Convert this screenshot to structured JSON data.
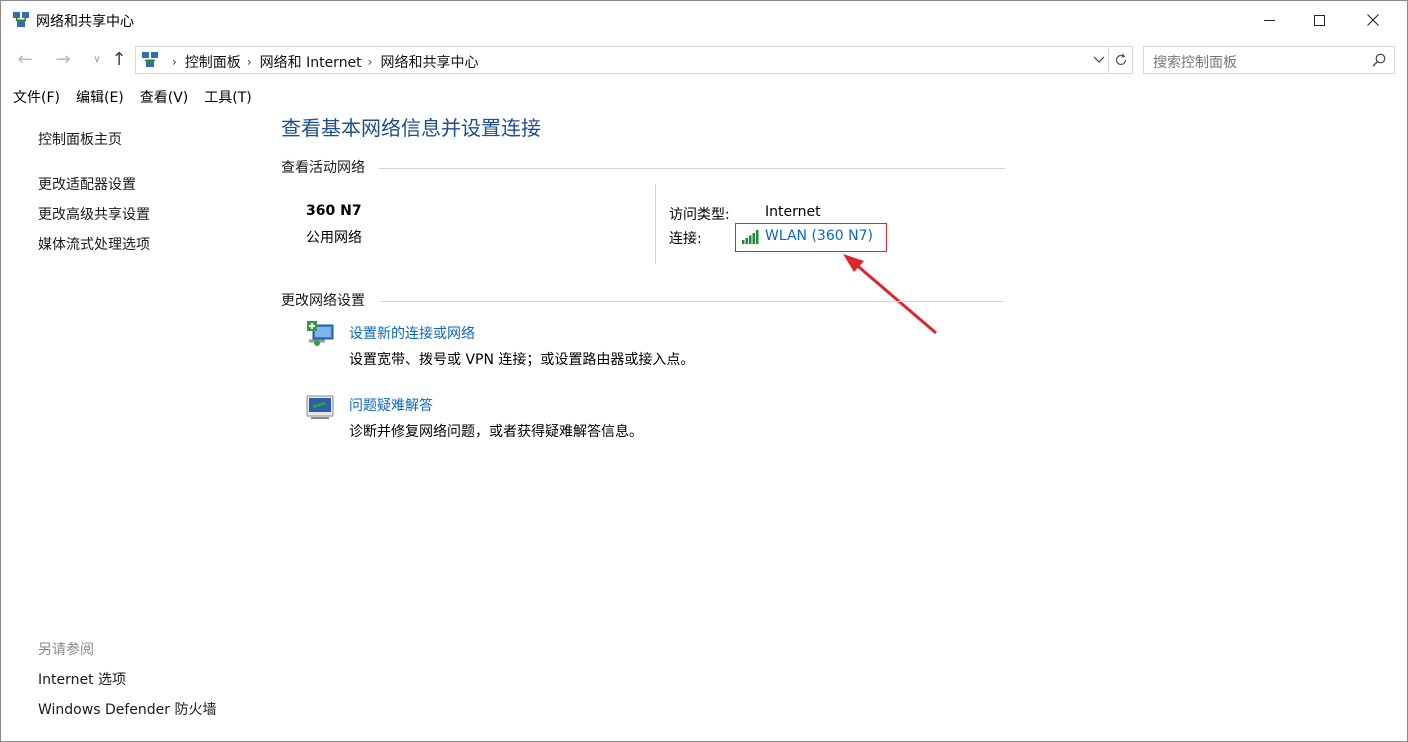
{
  "window": {
    "title": "网络和共享中心",
    "icon": "network-center-icon"
  },
  "nav": {
    "back": "←",
    "forward": "→",
    "recent": "∨",
    "up": "↑",
    "breadcrumbs": [
      "控制面板",
      "网络和 Internet",
      "网络和共享中心"
    ],
    "search_placeholder": "搜索控制面板"
  },
  "menu": [
    "文件(F)",
    "编辑(E)",
    "查看(V)",
    "工具(T)"
  ],
  "left_pane": {
    "home": "控制面板主页",
    "links": [
      "更改适配器设置",
      "更改高级共享设置",
      "媒体流式处理选项"
    ],
    "see_also_title": "另请参阅",
    "see_also": [
      "Internet 选项",
      "Windows Defender 防火墙"
    ]
  },
  "main": {
    "title": "查看基本网络信息并设置连接",
    "active_networks": {
      "header": "查看活动网络",
      "network_name": "360 N7",
      "network_type": "公用网络",
      "access_type_label": "访问类型:",
      "access_type_value": "Internet",
      "connection_label": "连接:",
      "connection_value": "WLAN (360 N7)"
    },
    "change_settings": {
      "header": "更改网络设置",
      "tasks": [
        {
          "title": "设置新的连接或网络",
          "desc": "设置宽带、拨号或 VPN 连接；或设置路由器或接入点。",
          "icon": "new-connection-icon"
        },
        {
          "title": "问题疑难解答",
          "desc": "诊断并修复网络问题，或者获得疑难解答信息。",
          "icon": "troubleshoot-icon"
        }
      ]
    }
  },
  "colors": {
    "title_blue": "#1e4e8c",
    "link_blue": "#0b66c2",
    "highlight_red": "#e0242b"
  }
}
